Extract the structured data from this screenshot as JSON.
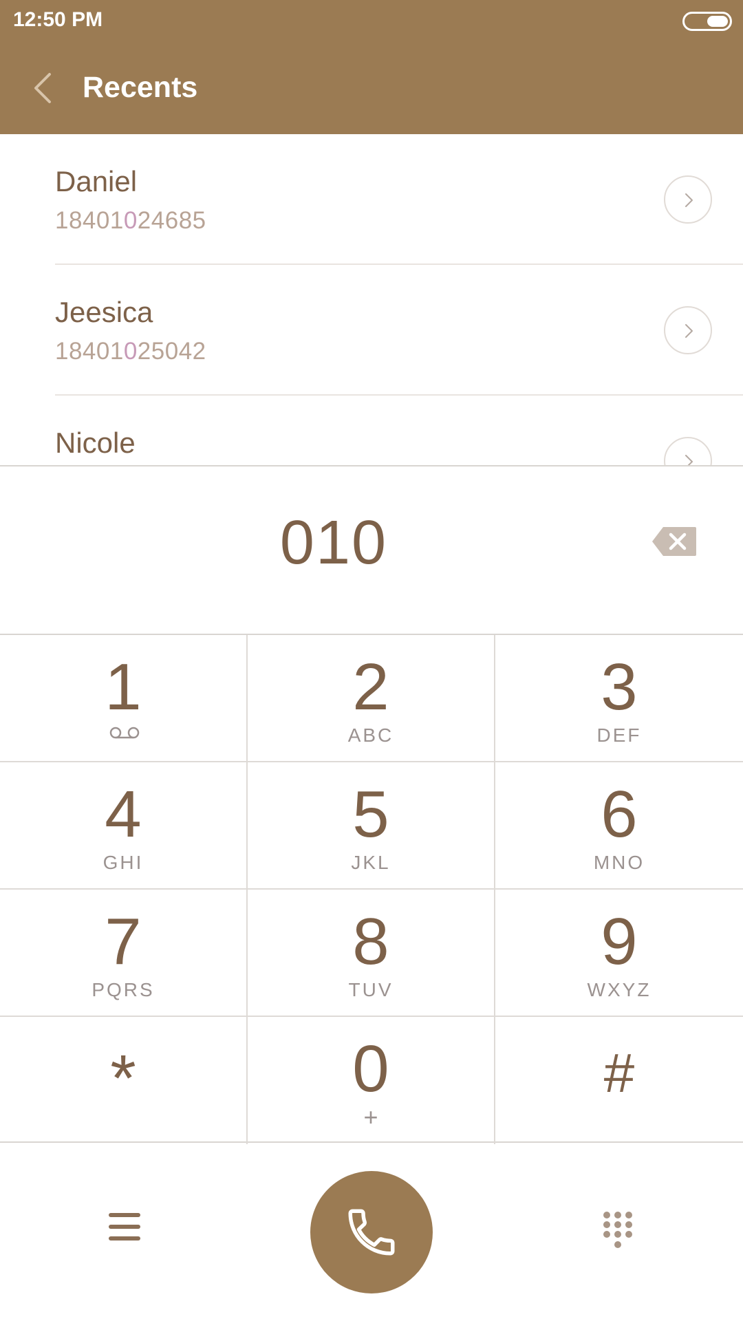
{
  "status_bar": {
    "time": "12:50 PM"
  },
  "header": {
    "title": "Recents"
  },
  "recents": [
    {
      "name": "Daniel",
      "number_prefix": "18401",
      "number_match": "0",
      "number_suffix": "24685"
    },
    {
      "name": "Jeesica",
      "number_prefix": "18401",
      "number_match": "0",
      "number_suffix": "25042"
    },
    {
      "name": "Nicole",
      "number_prefix": "",
      "number_match": "",
      "number_suffix": ""
    }
  ],
  "dialer": {
    "entered_digits": "010"
  },
  "keypad": [
    {
      "digit": "1",
      "letters": ""
    },
    {
      "digit": "2",
      "letters": "ABC"
    },
    {
      "digit": "3",
      "letters": "DEF"
    },
    {
      "digit": "4",
      "letters": "GHI"
    },
    {
      "digit": "5",
      "letters": "JKL"
    },
    {
      "digit": "6",
      "letters": "MNO"
    },
    {
      "digit": "7",
      "letters": "PQRS"
    },
    {
      "digit": "8",
      "letters": "TUV"
    },
    {
      "digit": "9",
      "letters": "WXYZ"
    },
    {
      "digit": "*",
      "letters": ""
    },
    {
      "digit": "0",
      "letters": "+"
    },
    {
      "digit": "#",
      "letters": ""
    }
  ],
  "icons": {
    "back": "chevron-left-icon",
    "detail": "chevron-right-circle-icon",
    "backspace": "backspace-icon",
    "voicemail": "voicemail-icon",
    "menu": "menu-icon",
    "call": "phone-icon",
    "dialpad": "dialpad-icon"
  },
  "colors": {
    "accent": "#9b7b53",
    "text": "#7d6149",
    "number_text": "#b8a395",
    "number_highlight": "#c79ab7"
  }
}
